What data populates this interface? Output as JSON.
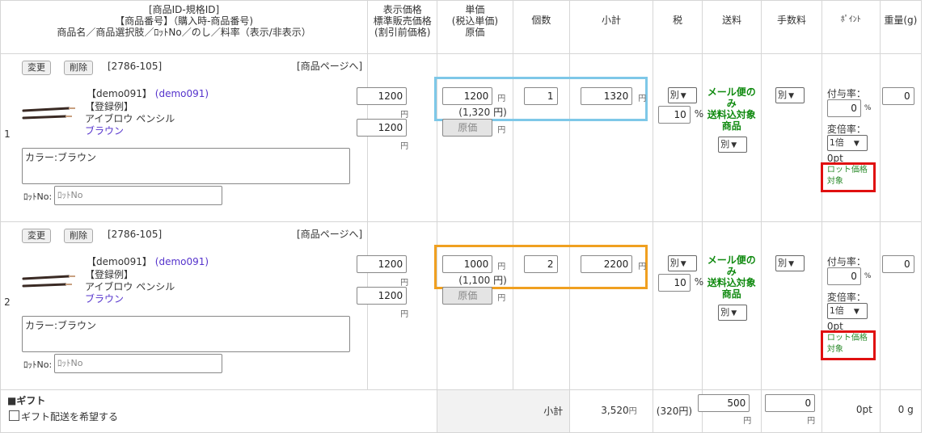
{
  "header": {
    "col_product": [
      "[商品ID-規格ID]",
      "【商品番号】（購入時-商品番号)",
      "商品名／商品選択肢／ﾛｯﾄNo／のし／料率（表示/非表示）"
    ],
    "col_price": [
      "表示価格",
      "標準販売価格",
      "(割引前価格)"
    ],
    "col_unit": [
      "単価",
      "(税込単価)",
      "原価"
    ],
    "col_qty": "個数",
    "col_subtotal": "小計",
    "col_tax": "税",
    "col_shipping": "送料",
    "col_fee": "手数料",
    "col_point": "ﾎﾟｲﾝﾄ",
    "col_weight": "重量(g)"
  },
  "rows": [
    {
      "no": "1",
      "change_label": "変更",
      "delete_label": "削除",
      "product_code": "[2786-105]",
      "product_page_link": "[商品ページへ]",
      "demo_code": "【demo091】",
      "demo_link": "(demo091)",
      "reg_example": "【登録例】",
      "product_name": "アイブロウ ペンシル",
      "variant": "ブラウン",
      "option_text": "カラー:ブラウン",
      "lot_label": "ﾛｯﾄNo:",
      "lot_placeholder": "ﾛｯﾄNo",
      "display_price": "1200",
      "standard_price": "1200",
      "yen": "円",
      "unit_price": "1200",
      "unit_price_tax": "(1,320 円)",
      "cost_placeholder": "原価",
      "qty": "1",
      "subtotal": "1320",
      "tax_select": "別",
      "tax_rate": "10",
      "percent": "%",
      "shipping_text": [
        "メール便の",
        "み",
        "送料込対象",
        "商品"
      ],
      "shipping_select": "別",
      "fee_select": "別",
      "grant_rate_label": "付与率：",
      "grant_rate": "0",
      "multiplier_label": "変倍率：",
      "multiplier": "1倍",
      "points": "0pt",
      "lot_price_text": [
        "ロット価格",
        "対象"
      ],
      "weight": "0",
      "highlight": "blue"
    },
    {
      "no": "2",
      "change_label": "変更",
      "delete_label": "削除",
      "product_code": "[2786-105]",
      "product_page_link": "[商品ページへ]",
      "demo_code": "【demo091】",
      "demo_link": "(demo091)",
      "reg_example": "【登録例】",
      "product_name": "アイブロウ ペンシル",
      "variant": "ブラウン",
      "option_text": "カラー:ブラウン",
      "lot_label": "ﾛｯﾄNo:",
      "lot_placeholder": "ﾛｯﾄNo",
      "display_price": "1200",
      "standard_price": "1200",
      "yen": "円",
      "unit_price": "1000",
      "unit_price_tax": "(1,100 円)",
      "cost_placeholder": "原価",
      "qty": "2",
      "subtotal": "2200",
      "tax_select": "別",
      "tax_rate": "10",
      "percent": "%",
      "shipping_text": [
        "メール便の",
        "み",
        "送料込対象",
        "商品"
      ],
      "shipping_select": "別",
      "fee_select": "別",
      "grant_rate_label": "付与率：",
      "grant_rate": "0",
      "multiplier_label": "変倍率：",
      "multiplier": "1倍",
      "points": "0pt",
      "lot_price_text": [
        "ロット価格",
        "対象"
      ],
      "weight": "0",
      "highlight": "orange"
    }
  ],
  "footer": {
    "gift_title": "■ギフト",
    "gift_checkbox_label": "ギフト配送を希望する",
    "subtotal_label": "小計",
    "subtotal_value": "3,520",
    "yen": "円",
    "tax_value": "(320円)",
    "shipping_value": "500",
    "fee_value": "0",
    "points_total": "0pt",
    "weight_total": "0 g"
  },
  "colors": {
    "highlight_blue": "#7ec8e8",
    "highlight_orange": "#f0a020",
    "highlight_red": "#e01010",
    "shipping_green": "#108a10",
    "link_purple": "#5533cc"
  }
}
